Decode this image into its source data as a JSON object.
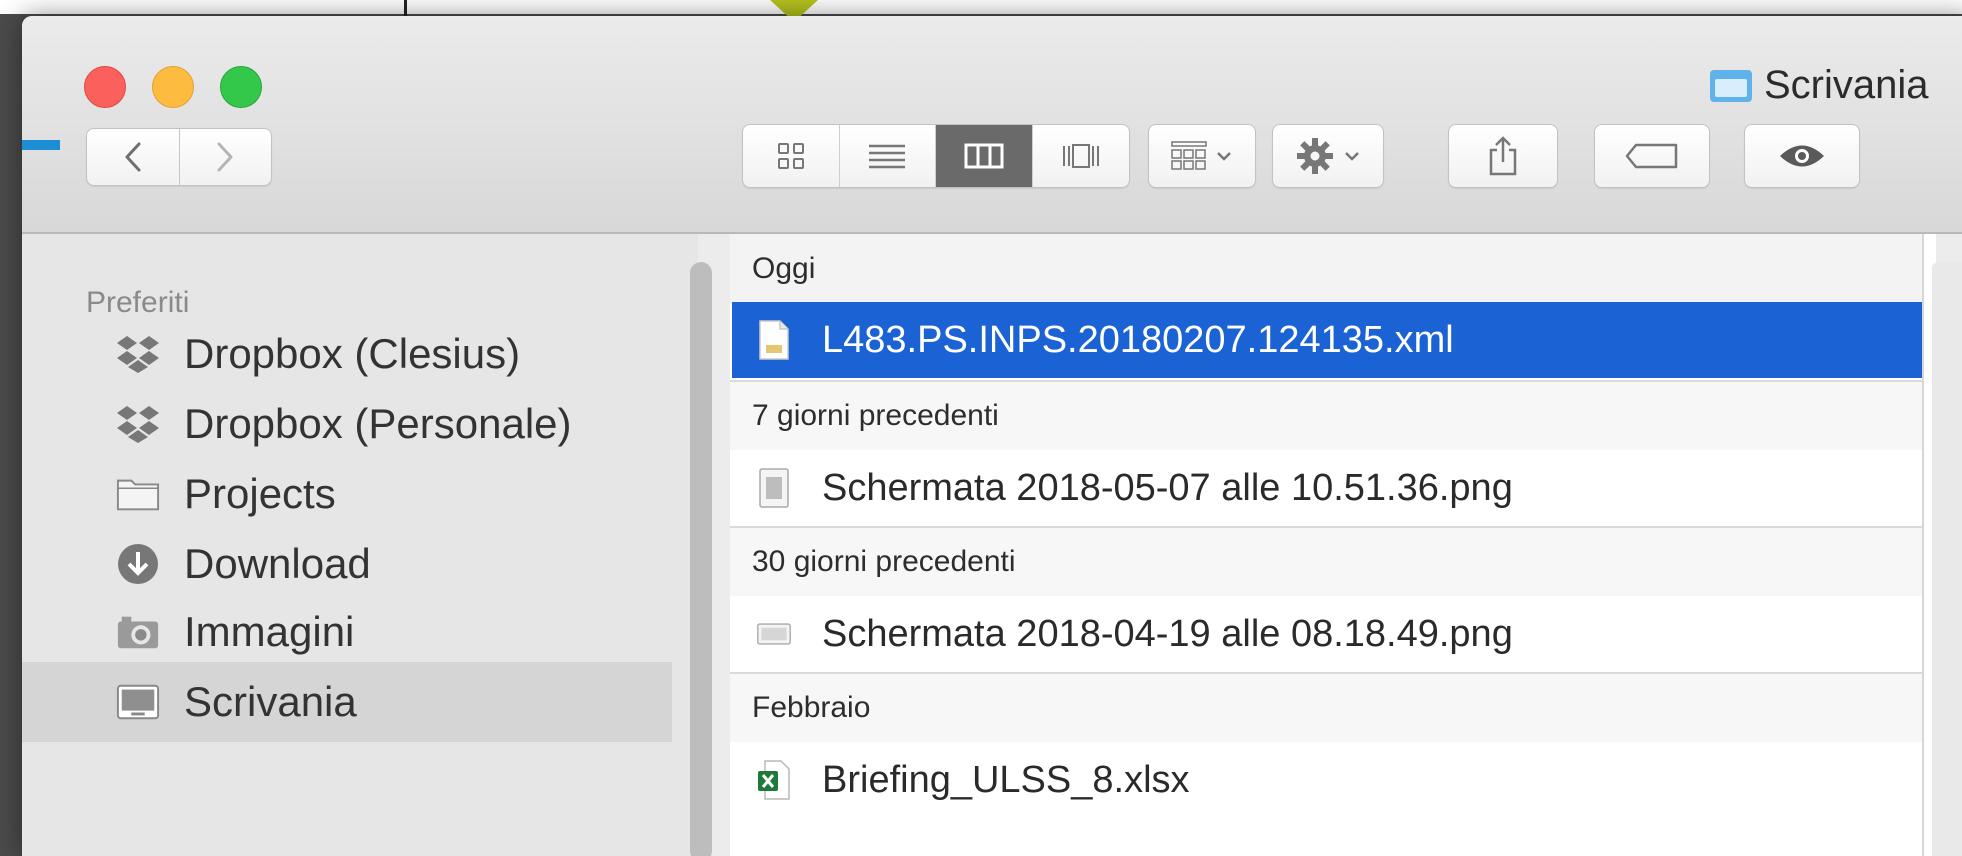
{
  "window": {
    "title": "Scrivania"
  },
  "toolbar": {
    "back": "back",
    "forward": "forward",
    "views": [
      "icon-view",
      "list-view",
      "column-view",
      "cover-flow-view"
    ],
    "active_view": "column-view"
  },
  "sidebar": {
    "header": "Preferiti",
    "items": [
      {
        "label": "Dropbox (Clesius)",
        "icon": "dropbox-icon"
      },
      {
        "label": "Dropbox (Personale)",
        "icon": "dropbox-icon"
      },
      {
        "label": "Projects",
        "icon": "folder-icon"
      },
      {
        "label": "Download",
        "icon": "download-icon"
      },
      {
        "label": "Immagini",
        "icon": "camera-icon"
      },
      {
        "label": "Scrivania",
        "icon": "desktop-icon",
        "selected": true
      }
    ]
  },
  "column": {
    "groups": [
      {
        "label": "Oggi",
        "files": [
          {
            "name": "L483.PS.INPS.20180207.124135.xml",
            "icon": "xml-file-icon",
            "selected": true
          }
        ]
      },
      {
        "label": "7 giorni precedenti",
        "files": [
          {
            "name": "Schermata 2018-05-07 alle 10.51.36.png",
            "icon": "image-file-icon"
          }
        ]
      },
      {
        "label": "30 giorni precedenti",
        "files": [
          {
            "name": "Schermata 2018-04-19 alle 08.18.49.png",
            "icon": "image-file-icon"
          }
        ]
      },
      {
        "label": "Febbraio",
        "files": [
          {
            "name": "Briefing_ULSS_8.xlsx",
            "icon": "excel-file-icon"
          }
        ]
      }
    ]
  },
  "colors": {
    "selection": "#1b63d4",
    "close": "#fc605c",
    "minimize": "#fdbc40",
    "zoom": "#34c84a"
  }
}
